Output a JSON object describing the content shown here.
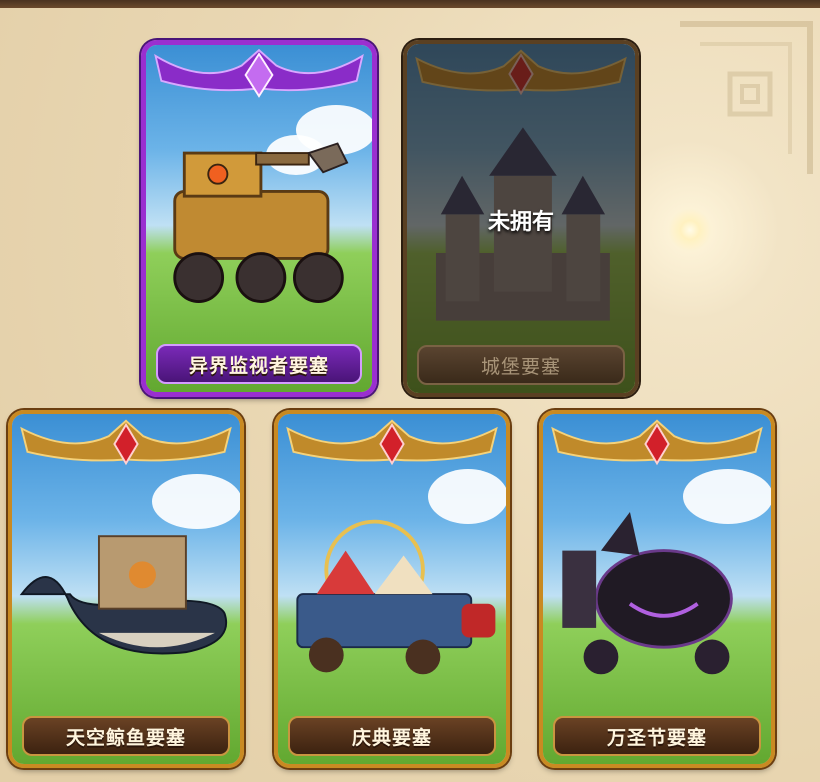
{
  "cards": [
    {
      "name": "异界监视者要塞",
      "rarity": "epic",
      "owned": true,
      "gem_color": "#c46cf0"
    },
    {
      "name": "城堡要塞",
      "rarity": "legendary",
      "owned": false,
      "locked_text": "未拥有",
      "gem_color": "#d2202a"
    },
    {
      "name": "天空鲸鱼要塞",
      "rarity": "legendary",
      "owned": true,
      "gem_color": "#d2202a"
    },
    {
      "name": "庆典要塞",
      "rarity": "legendary",
      "owned": true,
      "gem_color": "#d2202a"
    },
    {
      "name": "万圣节要塞",
      "rarity": "legendary",
      "owned": true,
      "gem_color": "#d2202a"
    }
  ],
  "colors": {
    "frame_gold": "#c98a22",
    "frame_purple": "#9a2fd0",
    "plate_brown": "#4e2e16"
  }
}
